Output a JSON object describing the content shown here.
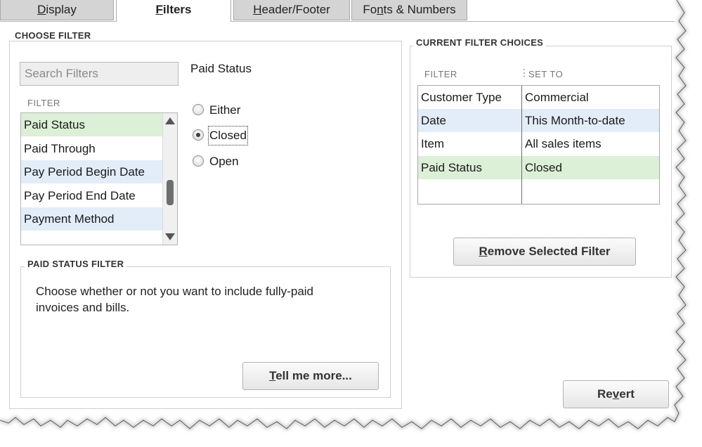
{
  "tabs": [
    {
      "label": "Display",
      "mnemonic": "D",
      "rest": "isplay",
      "active": false
    },
    {
      "label": "Filters",
      "mnemonic": "F",
      "rest": "ilters",
      "active": true
    },
    {
      "label": "Header/Footer",
      "mnemonic": "H",
      "rest": "eader/Footer",
      "active": false
    },
    {
      "label": "Fonts & Numbers",
      "pre": "Fo",
      "mnemonic": "n",
      "rest": "ts & Numbers",
      "active": false
    }
  ],
  "choose_filter": {
    "title": "CHOOSE FILTER",
    "search_placeholder": "Search Filters",
    "filter_col_label": "FILTER",
    "selected_filter_heading": "Paid Status",
    "filter_items": [
      "Paid Status",
      "Paid Through",
      "Pay Period Begin Date",
      "Pay Period End Date",
      "Payment Method"
    ],
    "selected_index": 0,
    "radio_options": [
      {
        "label": "Either",
        "checked": false
      },
      {
        "label": "Closed",
        "checked": true
      },
      {
        "label": "Open",
        "checked": false
      }
    ]
  },
  "paid_status_filter": {
    "title": "PAID STATUS FILTER",
    "description_line1": "Choose whether or not you want to include fully-paid",
    "description_line2": "invoices and bills.",
    "tell_me_more": {
      "mnemonic": "T",
      "rest": "ell me more..."
    }
  },
  "current_filter_choices": {
    "title": "CURRENT FILTER CHOICES",
    "col_filter": "FILTER",
    "col_set_to": "SET TO",
    "rows": [
      {
        "filter": "Customer Type",
        "set_to": "Commercial"
      },
      {
        "filter": "Date",
        "set_to": "This Month-to-date"
      },
      {
        "filter": "Item",
        "set_to": "All sales items"
      },
      {
        "filter": "Paid Status",
        "set_to": "Closed"
      }
    ],
    "remove_button": {
      "mnemonic": "R",
      "rest": "emove Selected Filter"
    }
  },
  "revert_button": {
    "pre": "Re",
    "mnemonic": "v",
    "rest": "ert"
  },
  "colors": {
    "row_alt_blue": "#e2edf9",
    "row_selected_green": "#dcefd7"
  }
}
